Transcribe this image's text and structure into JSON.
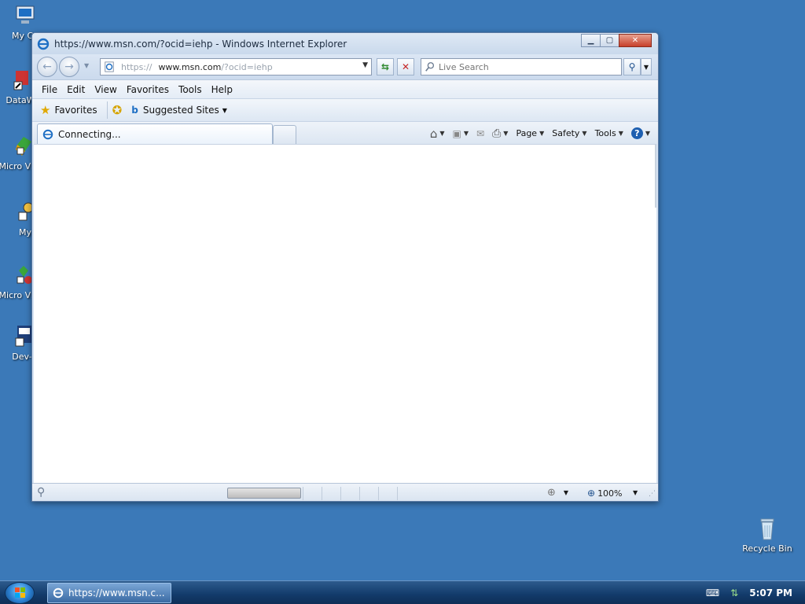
{
  "desktop": {
    "icons": [
      {
        "label": "My Co"
      },
      {
        "label": "DataW"
      },
      {
        "label": "Micro Visua"
      },
      {
        "label": "My"
      },
      {
        "label": "Micro Visua"
      },
      {
        "label": "Dev-"
      }
    ],
    "recycle_bin": "Recycle Bin"
  },
  "window": {
    "title": "https://www.msn.com/?ocid=iehp - Windows Internet Explorer",
    "address": {
      "prefix": "https://",
      "host": "www.msn.com",
      "suffix": "/?ocid=iehp"
    },
    "search_placeholder": "Live Search",
    "menu": [
      "File",
      "Edit",
      "View",
      "Favorites",
      "Tools",
      "Help"
    ],
    "favorites": {
      "favorites_label": "Favorites",
      "suggested_label": "Suggested Sites"
    },
    "tab_label": "Connecting...",
    "commands": {
      "page": "Page",
      "safety": "Safety",
      "tools": "Tools"
    },
    "status": {
      "zoom": "100%"
    }
  },
  "taskbar": {
    "task_label": "https://www.msn.c...",
    "clock": "5:07 PM"
  },
  "colors": {
    "desktop": "#3b79b8",
    "accent": "#1e6fc4"
  }
}
